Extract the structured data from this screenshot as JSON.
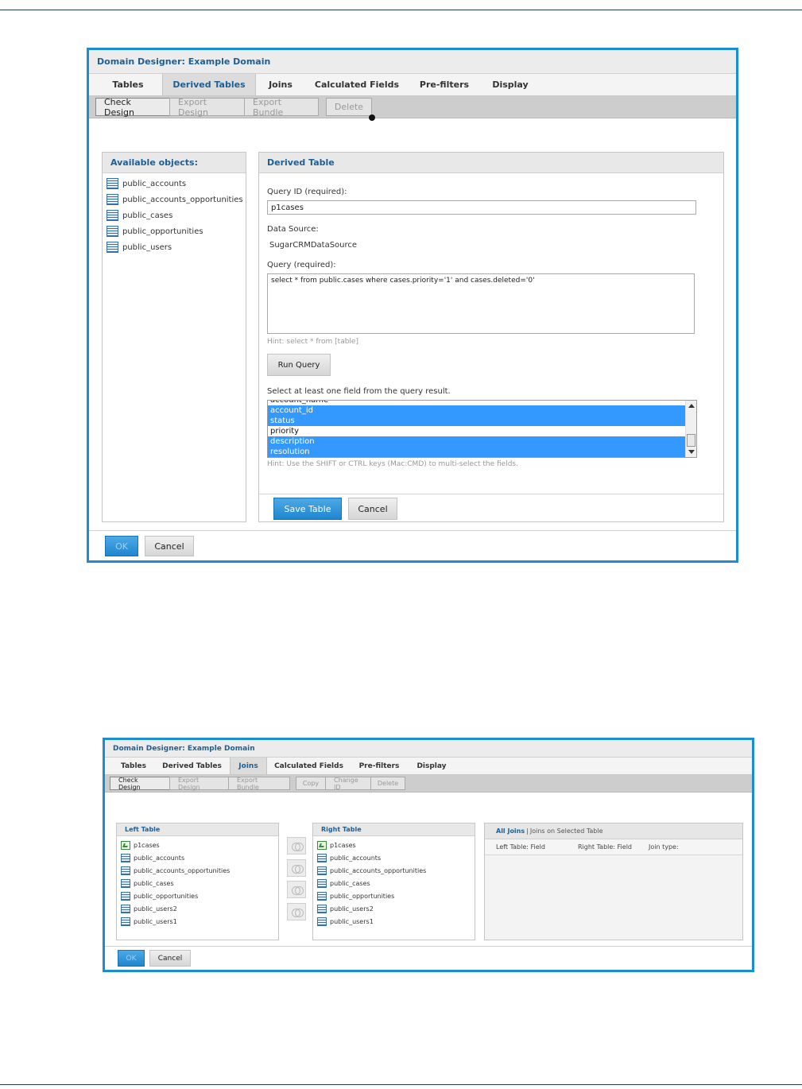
{
  "screen1": {
    "title": "Domain Designer: Example Domain",
    "tabs": [
      "Tables",
      "Derived Tables",
      "Joins",
      "Calculated Fields",
      "Pre-filters",
      "Display"
    ],
    "toolbar": [
      "Check Design",
      "Export Design",
      "Export Bundle",
      "Delete"
    ],
    "available_objects": {
      "heading": "Available objects:",
      "items": [
        "public_accounts",
        "public_accounts_opportunities",
        "public_cases",
        "public_opportunities",
        "public_users"
      ]
    },
    "derived_table": {
      "heading": "Derived Table",
      "query_id_label": "Query ID (required):",
      "query_id_value": "p1cases",
      "data_source_label": "Data Source:",
      "data_source_value": "SugarCRMDataSource",
      "query_label": "Query (required):",
      "query_value": "select * from public.cases where cases.priority='1' and cases.deleted='0'",
      "query_hint": "Hint: select * from [table]",
      "run_query": "Run Query",
      "fields_label": "Select at least one field from the query result.",
      "fields": [
        {
          "name": "account_name",
          "selected": false
        },
        {
          "name": "account_id",
          "selected": true
        },
        {
          "name": "status",
          "selected": true
        },
        {
          "name": "priority",
          "selected": false
        },
        {
          "name": "description",
          "selected": true
        },
        {
          "name": "resolution",
          "selected": true
        }
      ],
      "fields_hint": "Hint: Use the SHIFT or CTRL keys (Mac:CMD) to multi-select the fields.",
      "save_table": "Save Table",
      "cancel": "Cancel"
    },
    "footer": {
      "ok": "OK",
      "cancel": "Cancel"
    }
  },
  "screen2": {
    "title": "Domain Designer: Example Domain",
    "tabs": [
      "Tables",
      "Derived Tables",
      "Joins",
      "Calculated Fields",
      "Pre-filters",
      "Display"
    ],
    "toolbar": [
      "Check Design",
      "Export Design",
      "Export Bundle",
      "Copy",
      "Change ID",
      "Delete"
    ],
    "left_table": {
      "heading": "Left Table",
      "items": [
        "p1cases",
        "public_accounts",
        "public_accounts_opportunities",
        "public_cases",
        "public_opportunities",
        "public_users2",
        "public_users1"
      ]
    },
    "right_table": {
      "heading": "Right Table",
      "items": [
        "p1cases",
        "public_accounts",
        "public_accounts_opportunities",
        "public_cases",
        "public_opportunities",
        "public_users2",
        "public_users1"
      ]
    },
    "joins_panel": {
      "all_joins": "All Joins",
      "separator": "|",
      "joins_selected": "Joins on Selected Table",
      "columns": [
        "Left Table: Field",
        "Right Table: Field",
        "Join type:"
      ]
    },
    "footer": {
      "ok": "OK",
      "cancel": "Cancel"
    }
  }
}
